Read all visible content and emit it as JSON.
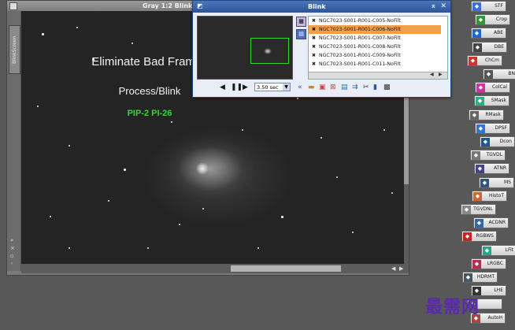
{
  "image_window": {
    "title": "Gray 1:2 BlinkS",
    "view_tab_label": "BlinkScreen",
    "overlay_title": "Eliminate Bad Frames",
    "overlay_subtitle": "Process/Blink",
    "overlay_tag": "PIP-2 PI-26",
    "overlay_tag_color": "#3fd23f"
  },
  "blink": {
    "title": "Blink",
    "files": [
      {
        "name": "NGC7023-S001-R001-C005-NoFilt",
        "selected": false
      },
      {
        "name": "NGC7023-S001-R001-C006-NoFilt",
        "selected": true
      },
      {
        "name": "NGC7023-S001-R001-C007-NoFilt",
        "selected": false
      },
      {
        "name": "NGC7023-S001-R001-C008-NoFilt",
        "selected": false
      },
      {
        "name": "NGC7023-S001-R001-C009-NoFilt",
        "selected": false
      },
      {
        "name": "NGC7023-S001-R001-C011-NoFilt",
        "selected": false
      }
    ],
    "speed": "3.50 sec",
    "selection_color": "#f0a04a"
  },
  "process_bar": {
    "items": [
      {
        "label": "STF",
        "icon": "stf-icon",
        "color": "#3a6fd8"
      },
      {
        "label": "Crop",
        "icon": "crop-icon",
        "color": "#2b9a3b"
      },
      {
        "label": "ABE",
        "icon": "abe-icon",
        "color": "#2266cc"
      },
      {
        "label": "DBE",
        "icon": "dbe-icon",
        "color": "#444"
      },
      {
        "label": "ChCm",
        "icon": "chcm-icon",
        "color": "#c33"
      },
      {
        "label": "BN",
        "icon": "bn-icon",
        "color": "#555"
      },
      {
        "label": "ColCal",
        "icon": "colcal-icon",
        "color": "#c3a"
      },
      {
        "label": "SMask",
        "icon": "smask-icon",
        "color": "#3a8"
      },
      {
        "label": "RMask",
        "icon": "rmask-icon",
        "color": "#666"
      },
      {
        "label": "DPSF",
        "icon": "dpsf-icon",
        "color": "#37c"
      },
      {
        "label": "Dcon",
        "icon": "dcon-icon",
        "color": "#258"
      },
      {
        "label": "TGVDL",
        "icon": "tgvdl-icon",
        "color": "#777"
      },
      {
        "label": "ATNR",
        "icon": "atnr-icon",
        "color": "#448"
      },
      {
        "label": "MS",
        "icon": "ms-icon",
        "color": "#357"
      },
      {
        "label": "HistoT",
        "icon": "histot-icon",
        "color": "#c63"
      },
      {
        "label": "TGVDNL",
        "icon": "tgvdnl-icon",
        "color": "#888"
      },
      {
        "label": "ACDNR",
        "icon": "acdnr-icon",
        "color": "#36a"
      },
      {
        "label": "RGBWS",
        "icon": "rgbws-icon",
        "color": "#c22"
      },
      {
        "label": "LFit",
        "icon": "lfit-icon",
        "color": "#2a8"
      },
      {
        "label": "LRGBC",
        "icon": "lrgbc-icon",
        "color": "#a35"
      },
      {
        "label": "HDRMT",
        "icon": "hdrmt-icon",
        "color": "#456"
      },
      {
        "label": "LHE",
        "icon": "lhe-icon",
        "color": "#333"
      },
      {
        "label": "",
        "icon": "process-icon",
        "color": "#555"
      },
      {
        "label": "AutoH",
        "icon": "autoh-icon",
        "color": "#a44"
      }
    ]
  },
  "watermark": "最需网"
}
